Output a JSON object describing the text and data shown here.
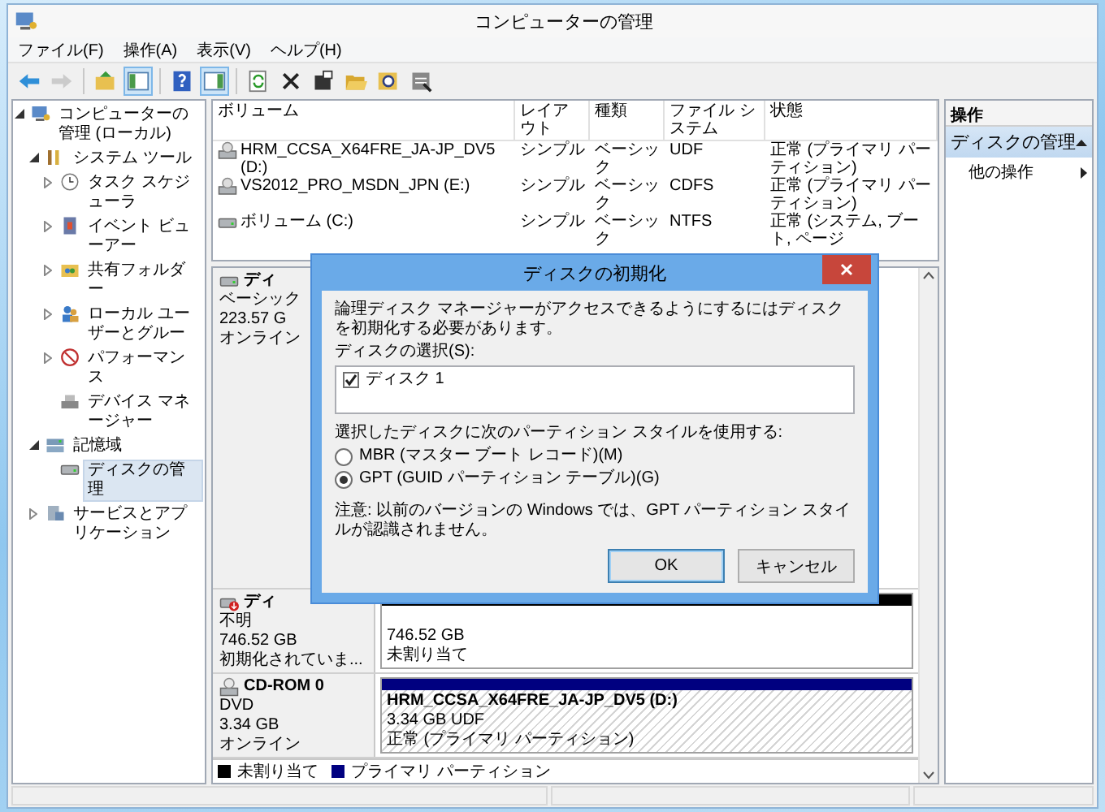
{
  "window": {
    "title": "コンピューターの管理"
  },
  "menu": [
    "ファイル(F)",
    "操作(A)",
    "表示(V)",
    "ヘルプ(H)"
  ],
  "toolbar": [
    {
      "kind": "button",
      "disabled": false,
      "pressed": false
    },
    {
      "kind": "button",
      "disabled": true,
      "pressed": false
    },
    {
      "kind": "separator"
    },
    {
      "kind": "button",
      "disabled": false,
      "pressed": false
    },
    {
      "kind": "button",
      "disabled": false,
      "pressed": true
    },
    {
      "kind": "separator"
    },
    {
      "kind": "button",
      "disabled": false,
      "pressed": false
    },
    {
      "kind": "button",
      "disabled": false,
      "pressed": true
    },
    {
      "kind": "separator"
    },
    {
      "kind": "button",
      "disabled": false,
      "pressed": false
    },
    {
      "kind": "button",
      "disabled": false,
      "pressed": false
    },
    {
      "kind": "button",
      "disabled": false,
      "pressed": false
    },
    {
      "kind": "button",
      "disabled": false,
      "pressed": false
    },
    {
      "kind": "button",
      "disabled": false,
      "pressed": false
    },
    {
      "kind": "button",
      "disabled": false,
      "pressed": false
    }
  ],
  "tree": [
    {
      "label": "コンピューターの管理 (ローカル)",
      "selected": false,
      "expanded": true,
      "children": [
        {
          "label": "システム ツール",
          "selected": false,
          "expanded": true,
          "children": [
            {
              "label": "タスク スケジューラ",
              "selected": false,
              "expanded": false
            },
            {
              "label": "イベント ビューアー",
              "selected": false,
              "expanded": false
            },
            {
              "label": "共有フォルダー",
              "selected": false,
              "expanded": false
            },
            {
              "label": "ローカル ユーザーとグルー",
              "selected": false,
              "expanded": false
            },
            {
              "label": "パフォーマンス",
              "selected": false,
              "expanded": false
            },
            {
              "label": "デバイス マネージャー",
              "selected": false
            }
          ]
        },
        {
          "label": "記憶域",
          "selected": false,
          "expanded": true,
          "children": [
            {
              "label": "ディスクの管理",
              "selected": true
            }
          ]
        },
        {
          "label": "サービスとアプリケーション",
          "selected": false,
          "expanded": false
        }
      ]
    }
  ],
  "table": {
    "columns": [
      "ボリューム",
      "レイアウト",
      "種類",
      "ファイル システム",
      "状態"
    ],
    "rows": [
      {
        "kind": "optical",
        "cells": [
          "HRM_CCSA_X64FRE_JA-JP_DV5 (D:)",
          "シンプル",
          "ベーシック",
          "UDF",
          "正常 (プライマリ パーティション)"
        ]
      },
      {
        "kind": "optical",
        "cells": [
          "VS2012_PRO_MSDN_JPN (E:)",
          "シンプル",
          "ベーシック",
          "CDFS",
          "正常 (プライマリ パーティション)"
        ]
      },
      {
        "kind": "disk",
        "cells": [
          "ボリューム (C:)",
          "シンプル",
          "ベーシック",
          "NTFS",
          "正常 (システム, ブート, ページ"
        ]
      }
    ]
  },
  "disks": [
    {
      "kind": "basic",
      "name": "ディ",
      "details": [
        "ベーシック",
        "223.57 G",
        "オンライン"
      ]
    },
    {
      "kind": "uninitialized",
      "name": "ディ",
      "details": [
        "不明",
        "746.52 GB",
        "初期化されていま..."
      ],
      "partition": {
        "color": "#000000",
        "selected": false,
        "lines": [
          "746.52 GB",
          "未割り当て"
        ]
      }
    },
    {
      "kind": "cdrom",
      "name": "CD-ROM 0",
      "details": [
        "DVD",
        "3.34 GB",
        "オンライン"
      ],
      "partition": {
        "color": "#000080",
        "selected": true,
        "title": "HRM_CCSA_X64FRE_JA-JP_DV5 (D:)",
        "lines": [
          "3.34 GB UDF",
          "正常 (プライマリ パーティション)"
        ]
      }
    }
  ],
  "legend": [
    {
      "label": "未割り当て",
      "color": "#000000"
    },
    {
      "label": "プライマリ パーティション",
      "color": "#000080"
    }
  ],
  "actions": {
    "title": "操作",
    "sections": [
      {
        "title": "ディスクの管理",
        "expanded": true,
        "items": [
          "他の操作"
        ]
      }
    ]
  },
  "dialog": {
    "title": "ディスクの初期化",
    "message": "論理ディスク マネージャーがアクセスできるようにするにはディスクを初期化する必要があります。",
    "list_label": "ディスクの選択(S):",
    "disks": [
      {
        "label": "ディスク 1",
        "checked": true
      }
    ],
    "style_label": "選択したディスクに次のパーティション スタイルを使用する:",
    "options": [
      {
        "label": "MBR (マスター ブート レコード)(M)",
        "selected": false
      },
      {
        "label": "GPT (GUID パーティション テーブル)(G)",
        "selected": true
      }
    ],
    "note": "注意: 以前のバージョンの Windows では、GPT パーティション スタイルが認識されません。",
    "buttons": [
      {
        "label": "OK",
        "default": true
      },
      {
        "label": "キャンセル",
        "default": false
      }
    ]
  }
}
